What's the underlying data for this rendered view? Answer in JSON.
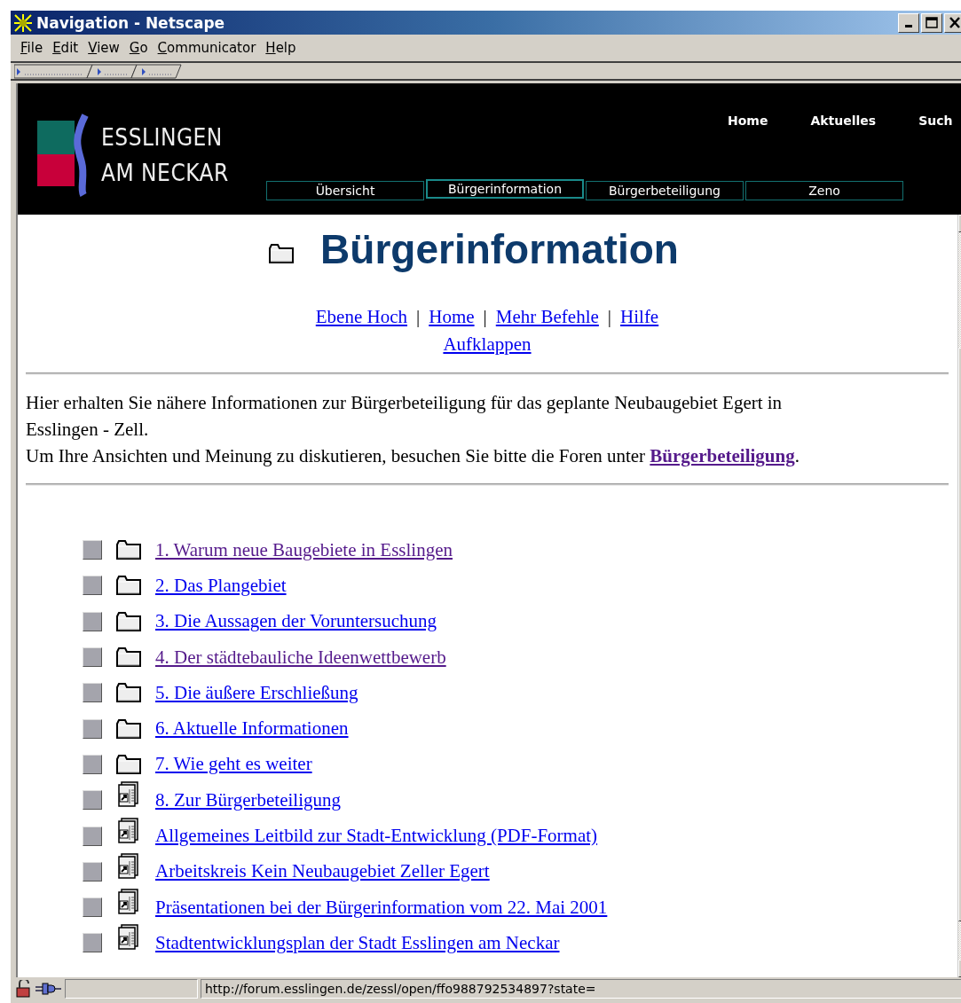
{
  "window": {
    "title": "Navigation - Netscape"
  },
  "menu": [
    {
      "label": "File"
    },
    {
      "label": "Edit"
    },
    {
      "label": "View"
    },
    {
      "label": "Go"
    },
    {
      "label": "Communicator"
    },
    {
      "label": "Help"
    }
  ],
  "site_header": {
    "logo": [
      "ESSLINGEN",
      "AM NECKAR"
    ],
    "top_links": [
      "Home",
      "Aktuelles",
      "Such"
    ],
    "tabs": [
      {
        "label": "Übersicht",
        "selected": false
      },
      {
        "label": "Bürgerinformation",
        "selected": true
      },
      {
        "label": "Bürgerbeteiligung",
        "selected": false
      },
      {
        "label": "Zeno",
        "selected": false
      }
    ]
  },
  "heading": "Bürgerinformation",
  "nav_links": [
    {
      "kind": "link",
      "label": "Ebene Hoch"
    },
    {
      "kind": "separator",
      "label": "|"
    },
    {
      "kind": "link",
      "label": "Home"
    },
    {
      "kind": "separator",
      "label": "|"
    },
    {
      "kind": "link",
      "label": "Mehr Befehle"
    },
    {
      "kind": "separator",
      "label": "|"
    },
    {
      "kind": "link",
      "label": "Hilfe"
    }
  ],
  "nav_links_2": [
    {
      "kind": "link",
      "label": "Aufklappen"
    }
  ],
  "intro": {
    "text": "Hier erhalten Sie nähere Informationen zur Bürgerbeteiligung für das geplante Neubaugebiet Egert in Esslingen - Zell.",
    "text_2": "Um Ihre Ansichten und Meinung zu diskutieren, besuchen Sie bitte die Foren unter ",
    "link": {
      "label": "Bürgerbeteiligung",
      "visited": true
    },
    "after": "."
  },
  "items": [
    {
      "label": "1. Warum neue Baugebiete in Esslingen",
      "kind": "folder",
      "visited": true
    },
    {
      "label": "2. Das Plangebiet",
      "kind": "folder",
      "visited": false
    },
    {
      "label": "3. Die Aussagen der Voruntersuchung",
      "kind": "folder",
      "visited": false
    },
    {
      "label": "4. Der städtebauliche Ideenwettbewerb",
      "kind": "folder",
      "visited": true
    },
    {
      "label": "5. Die äußere Erschließung",
      "kind": "folder",
      "visited": false
    },
    {
      "label": "6. Aktuelle Informationen",
      "kind": "folder",
      "visited": false
    },
    {
      "label": "7. Wie geht es weiter",
      "kind": "folder",
      "visited": false
    },
    {
      "label": "8. Zur Bürgerbeteiligung",
      "kind": "document",
      "visited": false
    },
    {
      "label": "Allgemeines Leitbild zur Stadt-Entwicklung (PDF-Format)",
      "kind": "document",
      "visited": false
    },
    {
      "label": "Arbeitskreis Kein Neubaugebiet Zeller Egert",
      "kind": "document",
      "visited": false
    },
    {
      "label": "Präsentationen bei der Bürgerinformation vom 22. Mai 2001",
      "kind": "document",
      "visited": false
    },
    {
      "label": "Stadtentwicklungsplan der Stadt Esslingen am Neckar",
      "kind": "document",
      "visited": false
    }
  ],
  "status_bar": {
    "url": "http://forum.esslingen.de/zessl/open/ffo988792534897?state="
  }
}
